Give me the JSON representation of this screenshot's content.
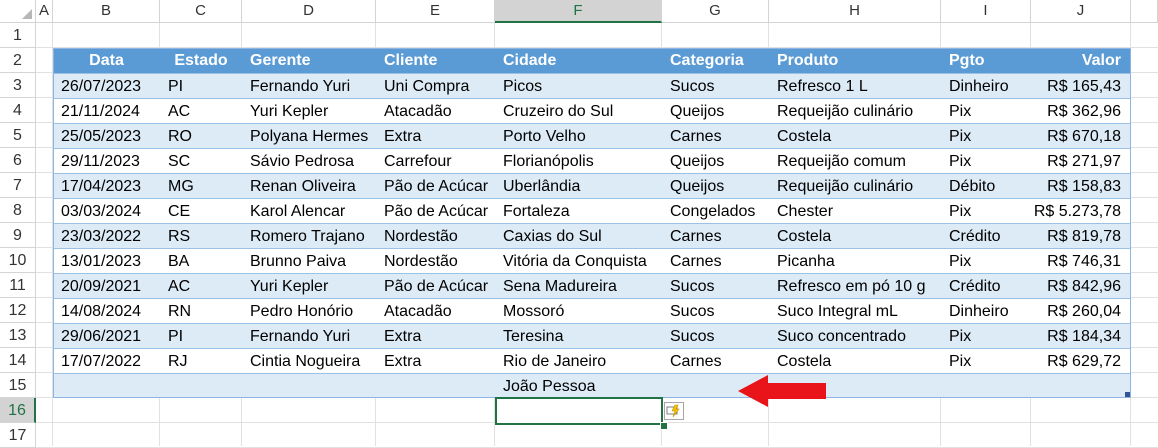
{
  "columns": [
    "A",
    "B",
    "C",
    "D",
    "E",
    "F",
    "G",
    "H",
    "I",
    "J"
  ],
  "selected_column": "F",
  "rows": [
    "1",
    "2",
    "3",
    "4",
    "5",
    "6",
    "7",
    "8",
    "9",
    "10",
    "11",
    "12",
    "13",
    "14",
    "15",
    "16",
    "17"
  ],
  "selected_row": "16",
  "table": {
    "headers": [
      "Data",
      "Estado",
      "Gerente",
      "Cliente",
      "Cidade",
      "Categoria",
      "Produto",
      "Pgto",
      "Valor"
    ],
    "rows": [
      [
        "26/07/2023",
        "PI",
        "Fernando Yuri",
        "Uni Compra",
        "Picos",
        "Sucos",
        "Refresco 1 L",
        "Dinheiro",
        "R$ 165,43"
      ],
      [
        "21/11/2024",
        "AC",
        "Yuri Kepler",
        "Atacadão",
        "Cruzeiro do Sul",
        "Queijos",
        "Requeijão culinário",
        "Pix",
        "R$ 362,96"
      ],
      [
        "25/05/2023",
        "RO",
        "Polyana Hermes",
        "Extra",
        "Porto Velho",
        "Carnes",
        "Costela",
        "Pix",
        "R$ 670,18"
      ],
      [
        "29/11/2023",
        "SC",
        "Sávio Pedrosa",
        "Carrefour",
        "Florianópolis",
        "Queijos",
        "Requeijão comum",
        "Pix",
        "R$ 271,97"
      ],
      [
        "17/04/2023",
        "MG",
        "Renan Oliveira",
        "Pão de Acúcar",
        "Uberlândia",
        "Queijos",
        "Requeijão culinário",
        "Débito",
        "R$ 158,83"
      ],
      [
        "03/03/2024",
        "CE",
        "Karol Alencar",
        "Pão de Acúcar",
        "Fortaleza",
        "Congelados",
        "Chester",
        "Pix",
        "R$ 5.273,78"
      ],
      [
        "23/03/2022",
        "RS",
        "Romero Trajano",
        "Nordestão",
        "Caxias do Sul",
        "Carnes",
        "Costela",
        "Crédito",
        "R$ 819,78"
      ],
      [
        "13/01/2023",
        "BA",
        "Brunno Paiva",
        "Nordestão",
        "Vitória da Conquista",
        "Carnes",
        "Picanha",
        "Pix",
        "R$ 746,31"
      ],
      [
        "20/09/2021",
        "AC",
        "Yuri Kepler",
        "Pão de Acúcar",
        "Sena Madureira",
        "Sucos",
        "Refresco em pó 10 g",
        "Crédito",
        "R$ 842,96"
      ],
      [
        "14/08/2024",
        "RN",
        "Pedro Honório",
        "Atacadão",
        "Mossoró",
        "Sucos",
        "Suco Integral mL",
        "Dinheiro",
        "R$ 260,04"
      ],
      [
        "29/06/2021",
        "PI",
        "Fernando Yuri",
        "Extra",
        "Teresina",
        "Sucos",
        "Suco concentrado",
        "Pix",
        "R$ 184,34"
      ],
      [
        "17/07/2022",
        "RJ",
        "Cintia Nogueira",
        "Extra",
        "Rio de Janeiro",
        "Carnes",
        "Costela",
        "Pix",
        "R$ 629,72"
      ],
      [
        "",
        "",
        "",
        "",
        "João Pessoa",
        "",
        "",
        "",
        ""
      ]
    ]
  },
  "colors": {
    "header_fill": "#5b9bd5",
    "band_fill": "#ddebf7",
    "selection": "#217346",
    "arrow": "#e8141a"
  },
  "icons": {
    "arrow": "red-arrow-icon",
    "autocorrect": "flash-fill-icon"
  }
}
